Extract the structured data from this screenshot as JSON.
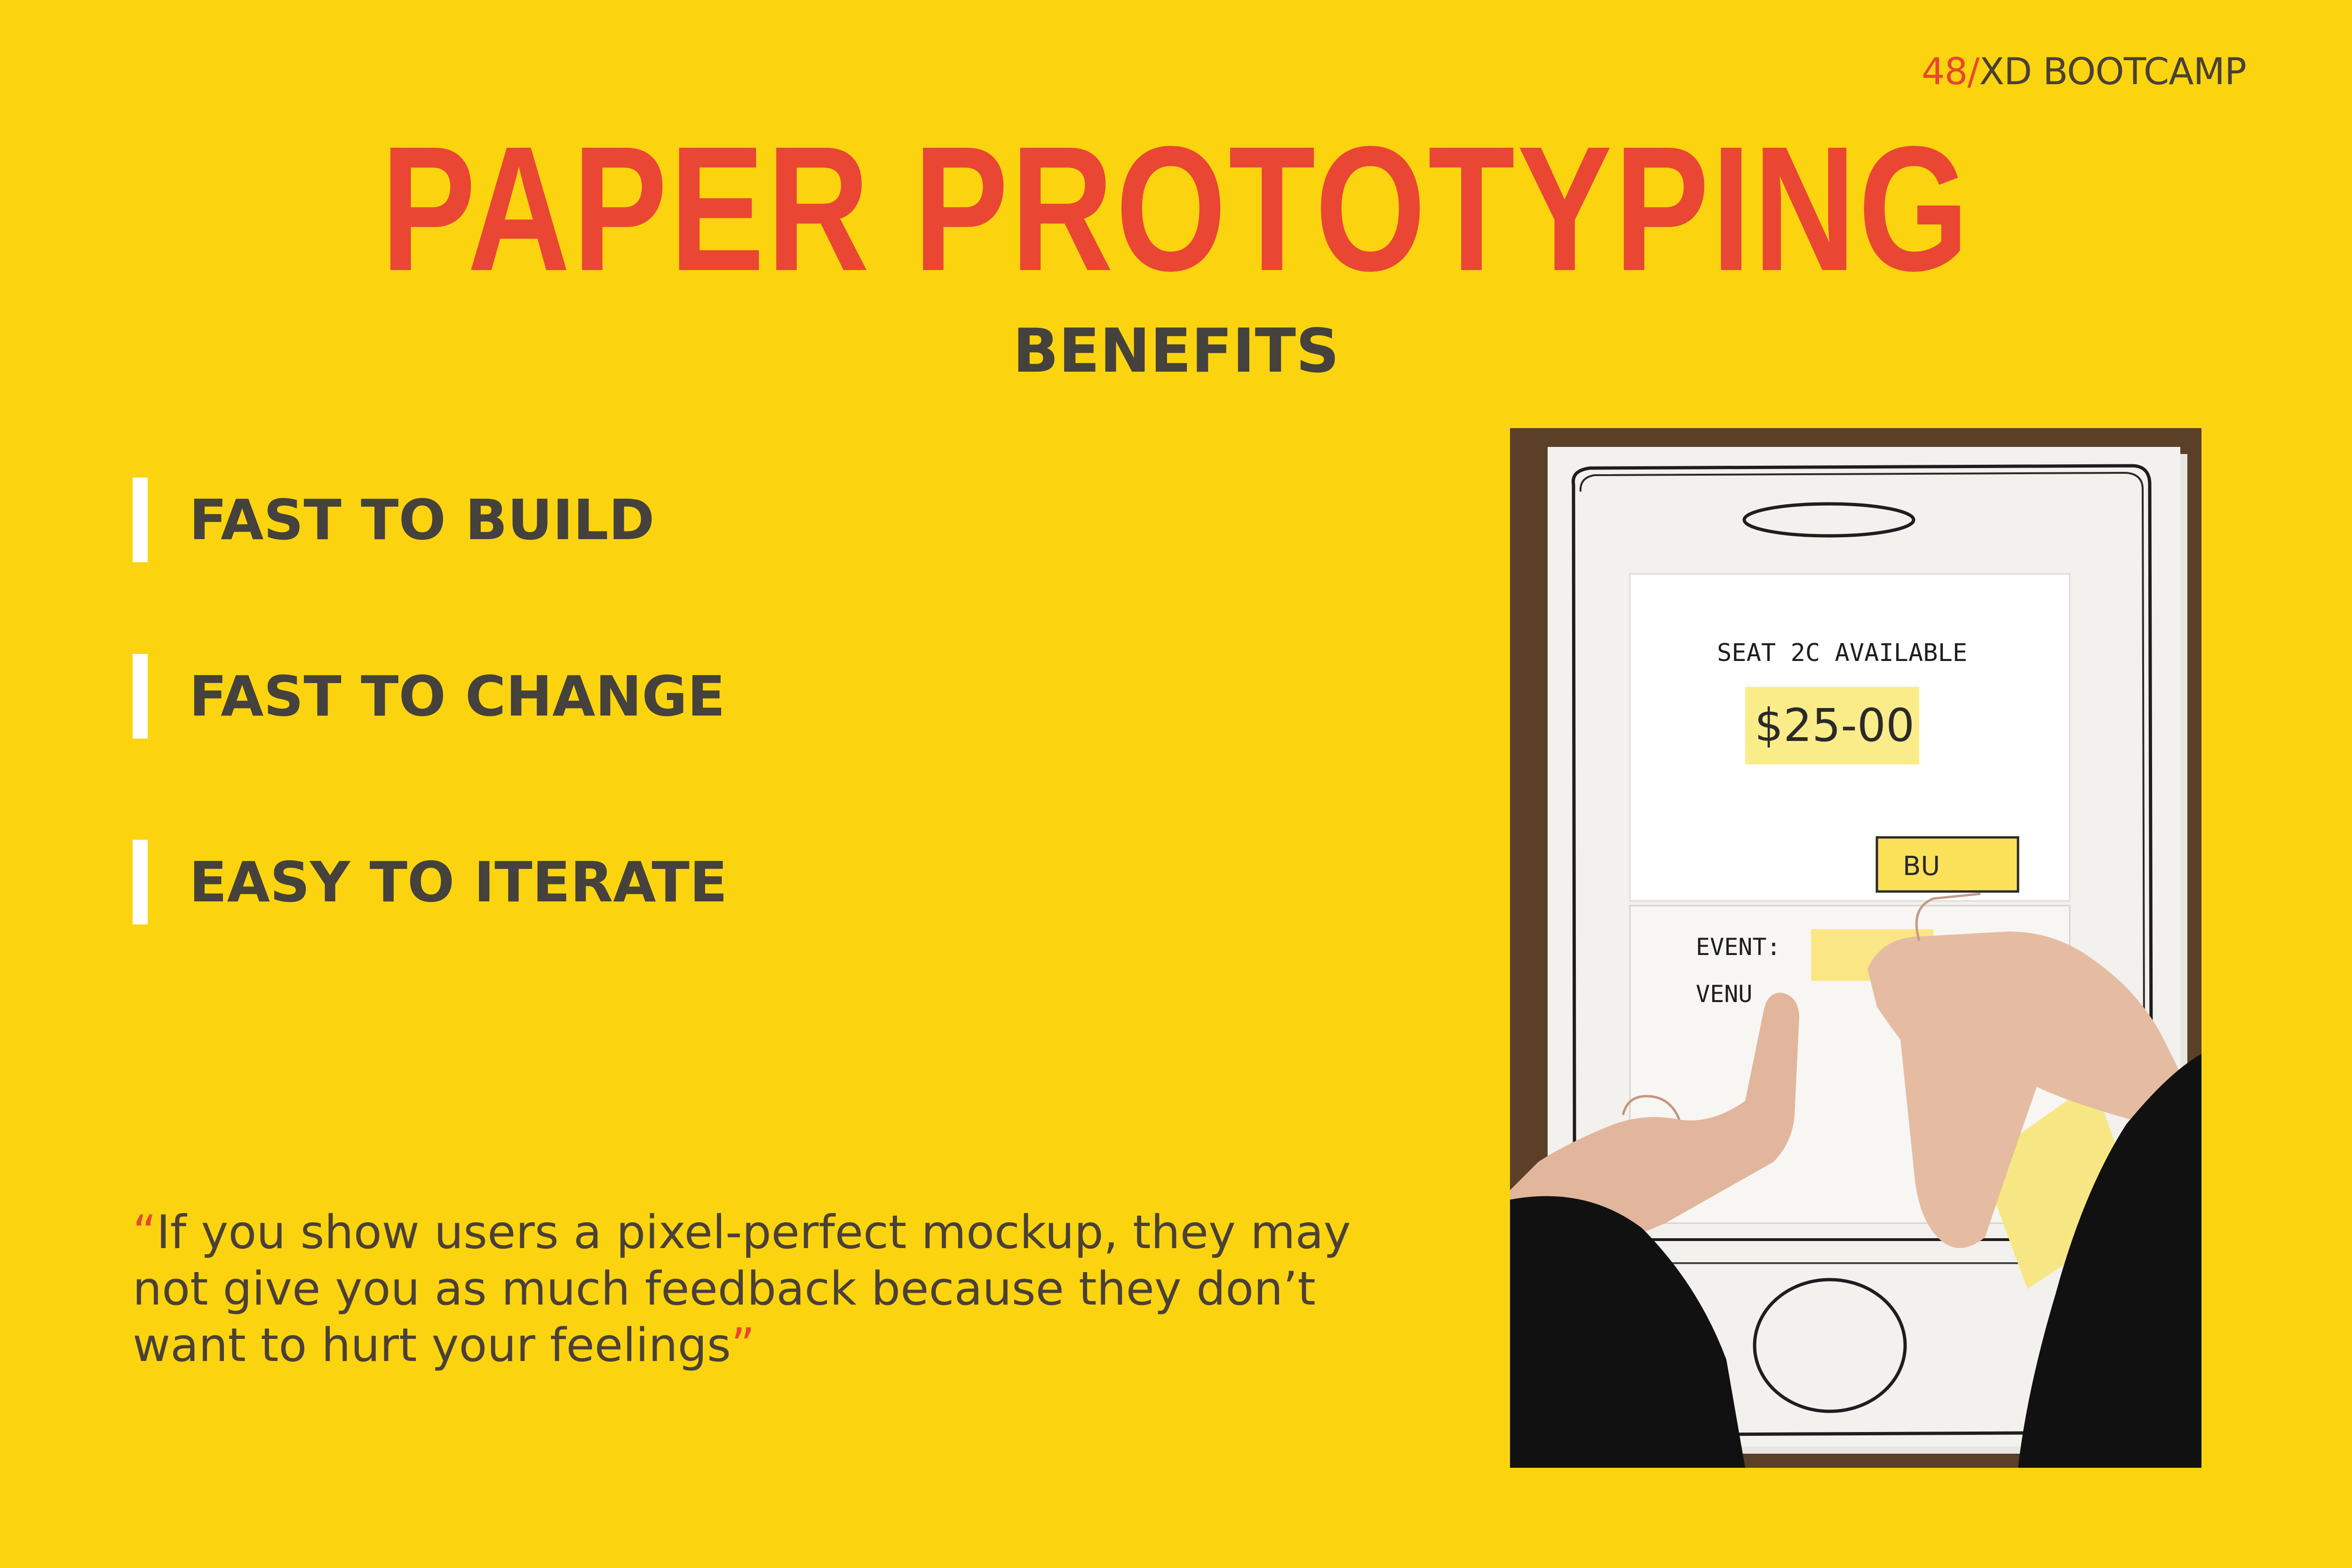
{
  "brand": {
    "number": "48",
    "slash": "/",
    "name": "XD BOOTCAMP"
  },
  "title": "PAPER PROTOTYPING",
  "subtitle": "BENEFITS",
  "benefits": [
    {
      "label": "FAST TO BUILD"
    },
    {
      "label": "FAST TO CHANGE"
    },
    {
      "label": "EASY TO ITERATE"
    }
  ],
  "quote": {
    "open_mark": "“",
    "text": "If you show users a pixel-perfect mockup, they may not give you as much feedback because they don’t want to hurt your feelings",
    "close_mark": "”"
  },
  "photo": {
    "seat_text": "SEAT 2C AVAILABLE",
    "price": "$25-00",
    "button_text": "BU",
    "event_label": "EVENT:",
    "venue_label": "VENU"
  },
  "colors": {
    "background": "#fbd40f",
    "title": "#ea4634",
    "text": "#45413c",
    "accent": "#e8472f",
    "bar": "#ffffff"
  }
}
